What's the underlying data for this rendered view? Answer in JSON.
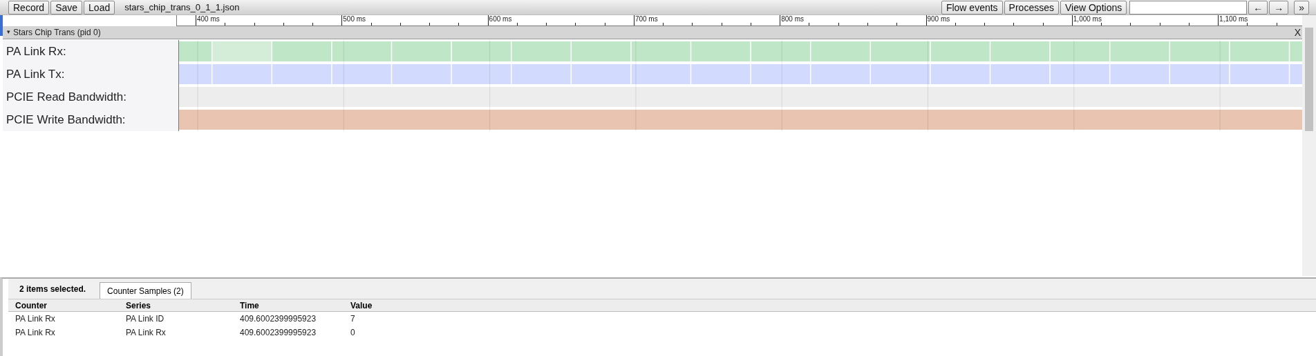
{
  "toolbar": {
    "buttons": [
      "Record",
      "Save",
      "Load"
    ],
    "filename": "stars_chip_trans_0_1_1.json",
    "right_buttons": [
      "Flow events",
      "Processes",
      "View Options"
    ],
    "nav_buttons": [
      "←",
      "→"
    ],
    "more_button": "»"
  },
  "ruler": {
    "ticks": [
      "400 ms",
      "500 ms",
      "600 ms",
      "700 ms",
      "800 ms",
      "900 ms",
      "1,000 ms",
      "1,100 ms"
    ]
  },
  "process": {
    "toggle": "▾",
    "title": "Stars Chip Trans (pid 0)",
    "close": "X",
    "tracks": [
      {
        "name": "PA Link Rx:",
        "color": "#c0e6c8",
        "kind": "segments"
      },
      {
        "name": "PA Link Tx:",
        "color": "#d2dafe",
        "kind": "segments"
      },
      {
        "name": "PCIE Read Bandwidth:",
        "color": "#ededed",
        "kind": "flat"
      },
      {
        "name": "PCIE Write Bandwidth:",
        "color": "#e8c4b1",
        "kind": "flat"
      }
    ]
  },
  "selection": {
    "summary": "2 items selected.",
    "tabs": [
      {
        "label": "Counter Samples (2)",
        "selected": true
      }
    ],
    "table": {
      "columns": [
        "Counter",
        "Series",
        "Time",
        "Value"
      ],
      "rows": [
        [
          "PA Link Rx",
          "PA Link ID",
          "409.6002399995923",
          "7"
        ],
        [
          "PA Link Rx",
          "PA Link Rx",
          "409.6002399995923",
          "0"
        ]
      ]
    }
  }
}
